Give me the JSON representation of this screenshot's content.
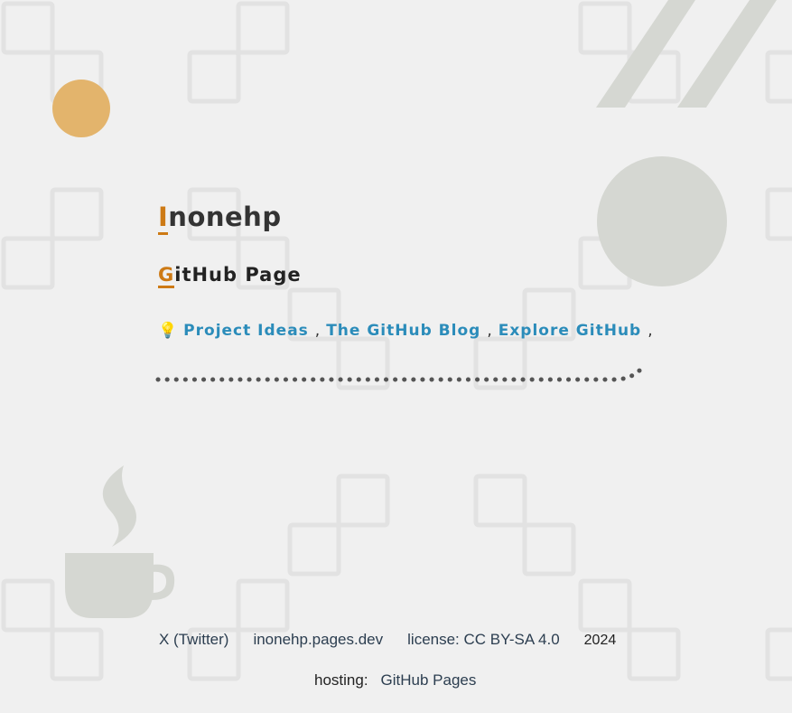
{
  "header": {
    "title_first": "I",
    "title_rest": "nonehp",
    "subtitle_first": "G",
    "subtitle_rest": "itHub Page"
  },
  "links": {
    "bulb_icon": "💡",
    "items": [
      {
        "label": "Project Ideas"
      },
      {
        "label": "The GitHub Blog"
      },
      {
        "label": "Explore GitHub"
      }
    ],
    "separator": ","
  },
  "footer": {
    "twitter": "X (Twitter)",
    "site": "inonehp.pages.dev",
    "license": "license: CC BY-SA 4.0",
    "year": "2024",
    "hosting_label": "hosting:",
    "hosting_link": "GitHub Pages"
  },
  "colors": {
    "background": "#f0f0f0",
    "accent": "#cd7a15",
    "link": "#2b8cba",
    "decoration": "#d5d7d2",
    "sun": "#e3b46c"
  },
  "icons": [
    "lightbulb-icon",
    "coffee-cup-icon"
  ]
}
